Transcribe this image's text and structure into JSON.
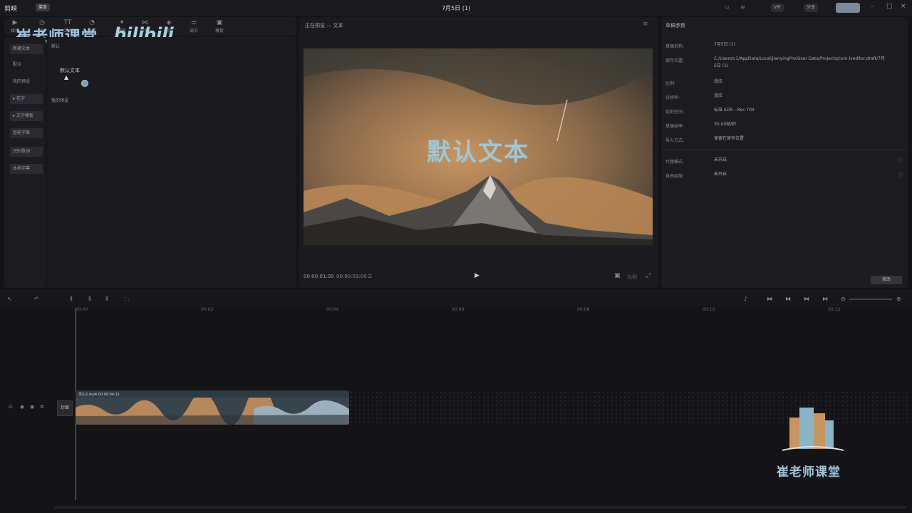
{
  "app": {
    "logo": "剪映",
    "menu": "菜单",
    "title": "7月5日 (1)"
  },
  "top_right": {
    "vip": "VIP",
    "share": "分享",
    "export_label": ""
  },
  "watermark": {
    "top_text": "崔老师课堂",
    "bili": "bilibili",
    "bottom_text": "崔老师课堂"
  },
  "left_sidebar": {
    "items": [
      {
        "label": "新建文本",
        "boxed": true
      },
      {
        "label": "默认",
        "boxed": false
      },
      {
        "label": "我的预设",
        "boxed": false
      },
      {
        "label": "▸ 花字",
        "boxed": true
      },
      {
        "label": "▸ 文字模板",
        "boxed": true
      },
      {
        "label": "智能字幕",
        "boxed": true
      },
      {
        "label": "识别歌词",
        "boxed": true
      },
      {
        "label": "本地字幕",
        "boxed": true
      }
    ]
  },
  "text_panel": {
    "section_default": "默认",
    "default_item": "默认文本",
    "section_presets": "我的预设"
  },
  "toolbar": {
    "tools": [
      {
        "label": "媒体",
        "icon": "media-icon"
      },
      {
        "label": "音频",
        "icon": "audio-icon"
      },
      {
        "label": "文本",
        "icon": "text-icon"
      },
      {
        "label": "贴纸",
        "icon": "sticker-icon"
      },
      {
        "label": "特效",
        "icon": "effects-icon"
      },
      {
        "label": "转场",
        "icon": "transition-icon"
      },
      {
        "label": "滤镜",
        "icon": "filter-icon"
      },
      {
        "label": "调节",
        "icon": "adjust-icon"
      },
      {
        "label": "模板",
        "icon": "template-icon"
      }
    ]
  },
  "player": {
    "title": "正在预览 — 文本",
    "overlay_text": "默认文本",
    "time_current": "00:00:01:00",
    "time_total": "00:00:03:00",
    "ratio": "比例"
  },
  "props": {
    "title": "草稿参数",
    "rows": [
      {
        "k": "草稿名称:",
        "v": "7月5日 (1)"
      },
      {
        "k": "保存位置:",
        "v": "C:/Users/c1/AppData/Local/JianyingPro/User Data/Projects/com.lveditor.draft/7月5日 (1)"
      },
      {
        "k": "比例:",
        "v": "适应"
      },
      {
        "k": "分辨率:",
        "v": "适应"
      },
      {
        "k": "色彩空间:",
        "v": "标准 SDR - Rec.709"
      },
      {
        "k": "草稿帧率:",
        "v": "30.00帧/秒"
      },
      {
        "k": "导入方式:",
        "v": "保留在原有位置"
      },
      {
        "k": "代理模式:",
        "v": "未开启"
      },
      {
        "k": "自由层级:",
        "v": "未开启"
      }
    ],
    "modify": "修改"
  },
  "timeline": {
    "ticks": [
      "00:00",
      "00:02",
      "00:04",
      "00:06",
      "00:08",
      "00:10",
      "00:12"
    ],
    "cover": "封面",
    "clip_name": "灵山2.mp4  00:00:04:11"
  }
}
